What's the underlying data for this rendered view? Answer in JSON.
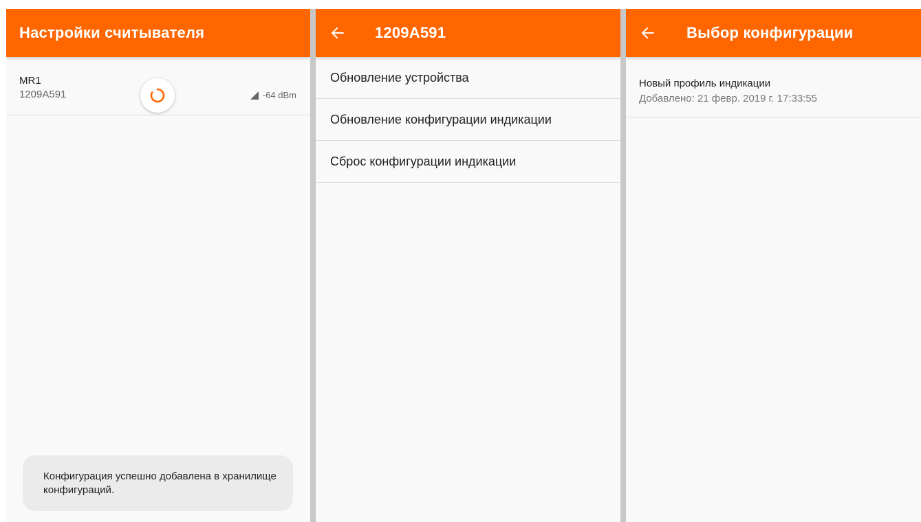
{
  "screen1": {
    "title": "Настройки считывателя",
    "device": {
      "name": "MR1",
      "id": "1209A591",
      "signal": "-64 dBm"
    },
    "toast": "Конфигурация успешно добавлена в хранилище конфигураций."
  },
  "screen2": {
    "title": "1209A591",
    "items": [
      {
        "label": "Обновление устройства"
      },
      {
        "label": "Обновление конфигурации индикации"
      },
      {
        "label": "Сброс конфигурации индикации"
      }
    ]
  },
  "screen3": {
    "title": "Выбор конфигурации",
    "profile": {
      "name": "Новый профиль индикации",
      "added": "Добавлено: 21 февр. 2019 г. 17:33:55"
    }
  },
  "colors": {
    "accent": "#ff6600",
    "background": "#f9f9f9",
    "divider": "#dcdcdc"
  },
  "icons": {
    "back": "arrow-back-icon",
    "loading": "loading-spinner-icon",
    "signal": "signal-strength-icon"
  }
}
